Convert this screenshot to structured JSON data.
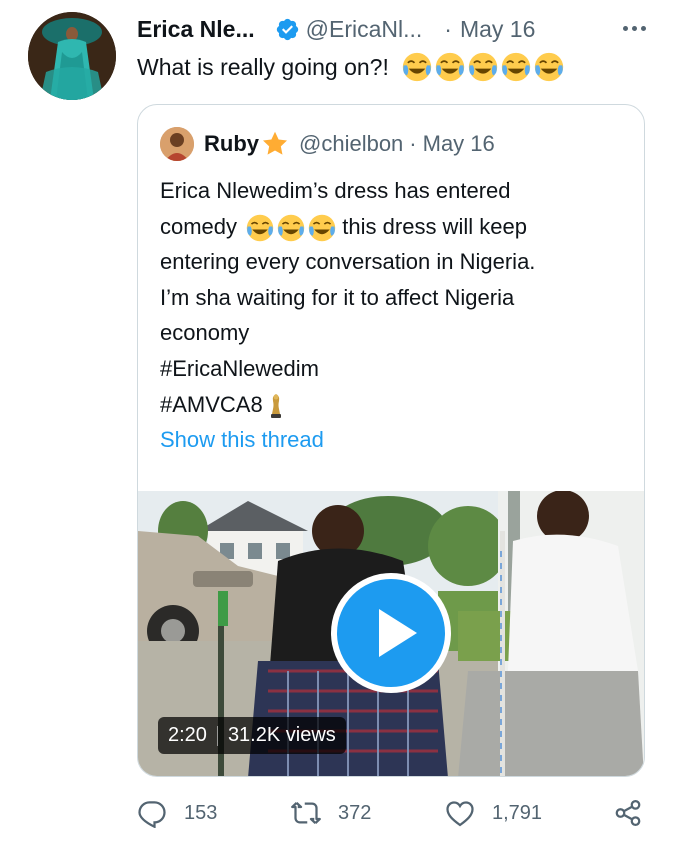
{
  "tweet": {
    "author_name": "Erica Nle...",
    "author_handle": "@EricaNl...",
    "date_sep": "·",
    "date": "May 16",
    "text": "What is really going on?!",
    "emoji": "joy-emoji",
    "emoji_count": 5
  },
  "quoted": {
    "author_name": "Ruby",
    "author_badge": "star-emoji",
    "author_handle": "@chielbon",
    "date_sep": "·",
    "date": "May 16",
    "lines": {
      "l1": "Erica Nlewedim’s dress has entered",
      "l2a": "comedy",
      "l2b": "this dress will keep",
      "l3": "entering every conversation in Nigeria.",
      "l4": "I’m sha waiting for it to affect Nigeria",
      "l5": "economy",
      "l6": "#EricaNlewedim",
      "l7": "#AMVCA8"
    },
    "show_thread": "Show this thread",
    "video": {
      "duration": "2:20",
      "views": "31.2K views"
    }
  },
  "actions": {
    "replies": "153",
    "retweets": "372",
    "likes": "1,791"
  },
  "colors": {
    "accent": "#1d9bf0",
    "verified": "#1d9bf0",
    "text_secondary": "#536471",
    "border": "#cfd9de"
  },
  "icons": {
    "verified": "verified-badge-icon",
    "more": "more-dots-icon",
    "play": "play-icon",
    "reply": "reply-icon",
    "retweet": "retweet-icon",
    "like": "heart-icon",
    "share": "share-icon",
    "trophy": "trophy-emoji"
  }
}
